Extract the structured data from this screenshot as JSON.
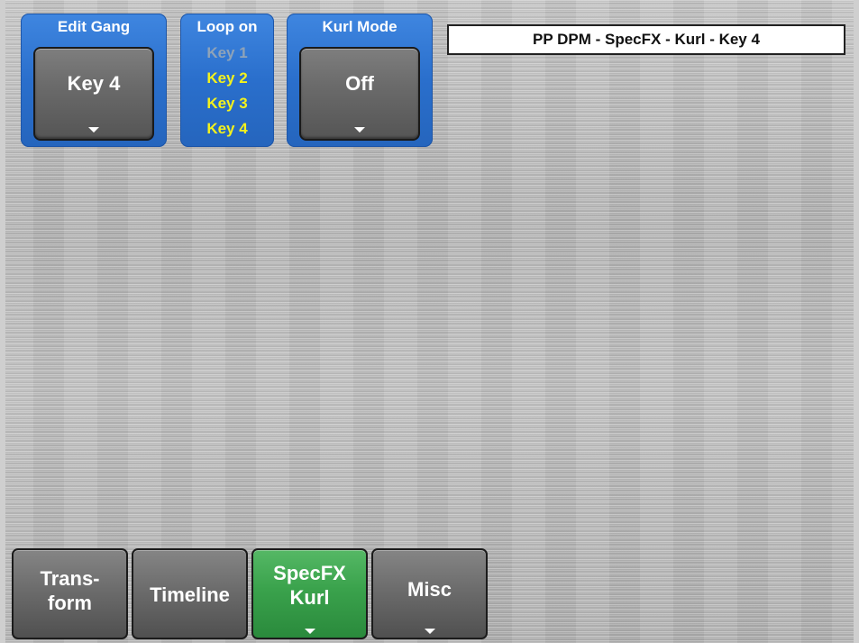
{
  "edit_gang": {
    "title": "Edit Gang",
    "value": "Key 4"
  },
  "loop_on": {
    "title": "Loop on",
    "items": [
      {
        "label": "Key 1",
        "state": "dim"
      },
      {
        "label": "Key 2",
        "state": "on"
      },
      {
        "label": "Key 3",
        "state": "on"
      },
      {
        "label": "Key 4",
        "state": "on"
      }
    ]
  },
  "kurl_mode": {
    "title": "Kurl Mode",
    "value": "Off"
  },
  "status": {
    "text": "PP DPM - SpecFX - Kurl - Key 4"
  },
  "tabs": [
    {
      "label": "Trans-\nform",
      "active": false,
      "has_menu": false
    },
    {
      "label": "Timeline",
      "active": false,
      "has_menu": false
    },
    {
      "label": "SpecFX\nKurl",
      "active": true,
      "has_menu": true
    },
    {
      "label": "Misc",
      "active": false,
      "has_menu": true
    }
  ],
  "colors": {
    "group_blue": "#2a6fcc",
    "loop_on_yellow": "#f4f21c",
    "loop_off_grey": "#8fa3b8",
    "active_tab_green": "#3aa24c",
    "button_grey": "#6b6b6b",
    "background_silver": "#bcbcbc"
  }
}
